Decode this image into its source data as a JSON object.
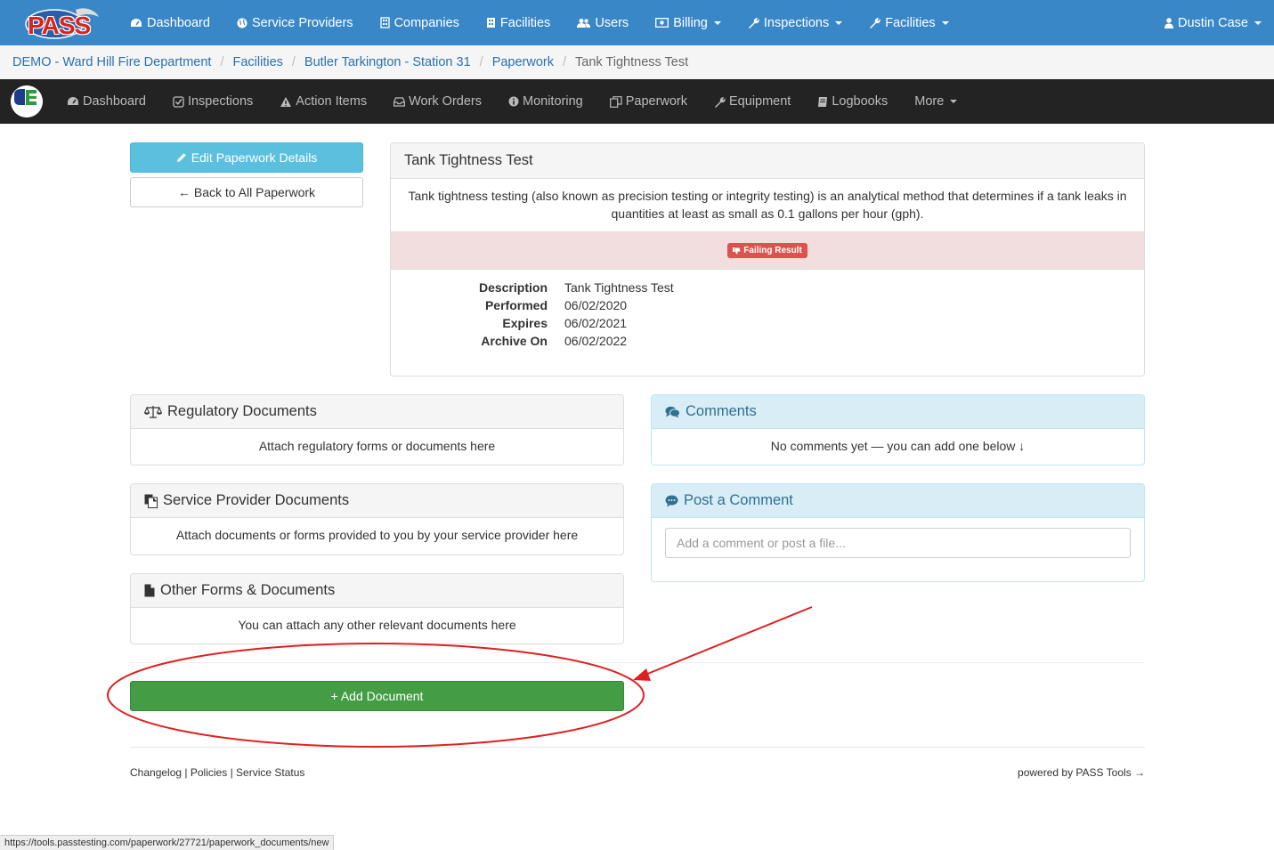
{
  "topnav": {
    "items": [
      {
        "label": "Dashboard",
        "icon": "dashboard-icon"
      },
      {
        "label": "Service Providers",
        "icon": "globe-icon"
      },
      {
        "label": "Companies",
        "icon": "building-icon"
      },
      {
        "label": "Facilities",
        "icon": "building-icon"
      },
      {
        "label": "Users",
        "icon": "users-icon"
      },
      {
        "label": "Billing",
        "icon": "money-icon"
      },
      {
        "label": "Inspections",
        "icon": "wrench-icon"
      },
      {
        "label": "Facilities",
        "icon": "wrench-icon"
      }
    ],
    "user": "Dustin Case",
    "logo_text": "PASS"
  },
  "breadcrumb": {
    "items": [
      "DEMO - Ward Hill Fire Department",
      "Facilities",
      "Butler Tarkington - Station 31",
      "Paperwork"
    ],
    "active": "Tank Tightness Test"
  },
  "subnav": {
    "items": [
      {
        "label": "Dashboard",
        "icon": "dashboard-icon"
      },
      {
        "label": "Inspections",
        "icon": "check-square-icon"
      },
      {
        "label": "Action Items",
        "icon": "warning-icon"
      },
      {
        "label": "Work Orders",
        "icon": "inbox-icon"
      },
      {
        "label": "Monitoring",
        "icon": "info-circle-icon"
      },
      {
        "label": "Paperwork",
        "icon": "copy-icon"
      },
      {
        "label": "Equipment",
        "icon": "wrench-icon"
      },
      {
        "label": "Logbooks",
        "icon": "book-icon"
      }
    ],
    "more": "More"
  },
  "actions": {
    "edit": "Edit Paperwork Details",
    "back": "← Back to All Paperwork"
  },
  "detail": {
    "title": "Tank Tightness Test",
    "description": "Tank tightness testing (also known as precision testing or integrity testing) is an analytical method that determines if a tank leaks in quantities at least as small as 0.1 gallons per hour (gph).",
    "badge": "Failing Result",
    "fields": [
      {
        "label": "Description",
        "value": "Tank Tightness Test"
      },
      {
        "label": "Performed",
        "value": "06/02/2020"
      },
      {
        "label": "Expires",
        "value": "06/02/2021"
      },
      {
        "label": "Archive On",
        "value": "06/02/2022"
      }
    ]
  },
  "regulatory": {
    "title": "Regulatory Documents",
    "body": "Attach regulatory forms or documents here"
  },
  "service_provider_docs": {
    "title": "Service Provider Documents",
    "body": "Attach documents or forms provided to you by your service provider here"
  },
  "other_docs": {
    "title": "Other Forms & Documents",
    "body": "You can attach any other relevant documents here"
  },
  "comments": {
    "title": "Comments",
    "body": "No comments yet — you can add one below ↓"
  },
  "post_comment": {
    "title": "Post a Comment",
    "placeholder": "Add a comment or post a file..."
  },
  "add_document": "+ Add Document",
  "footer": {
    "links": [
      "Changelog",
      "Policies",
      "Service Status"
    ],
    "powered": "powered by PASS Tools →"
  },
  "status_url": "https://tools.passtesting.com/paperwork/27721/paperwork_documents/new",
  "colors": {
    "topnav": "#3a87c8",
    "subnav": "#232323",
    "info_btn": "#5bc0de",
    "success_btn": "#449d44",
    "danger": "#d9534f",
    "annotation": "#e02020"
  }
}
